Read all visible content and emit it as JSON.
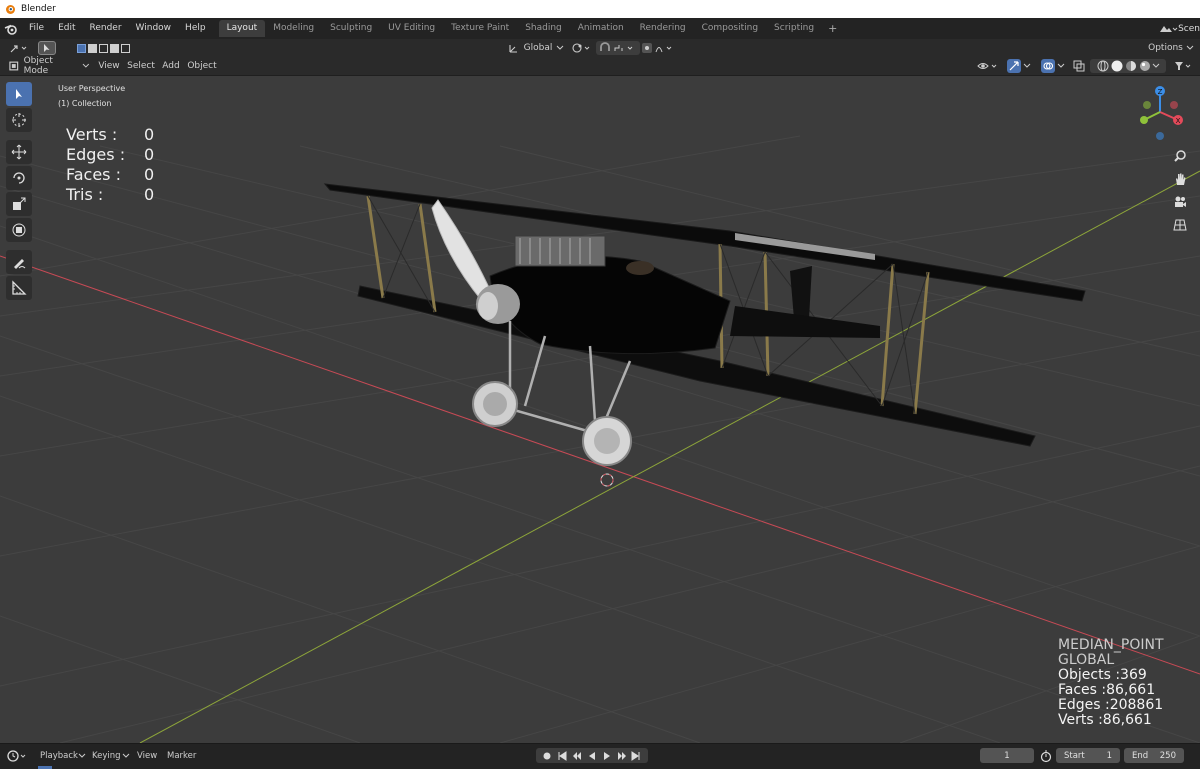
{
  "window": {
    "title": "Blender"
  },
  "menu": [
    "File",
    "Edit",
    "Render",
    "Window",
    "Help"
  ],
  "workspaces": [
    "Layout",
    "Modeling",
    "Sculpting",
    "UV Editing",
    "Texture Paint",
    "Shading",
    "Animation",
    "Rendering",
    "Compositing",
    "Scripting"
  ],
  "workspace_add": "+",
  "scene_label": "Scen",
  "tool_header": {
    "orientation": "Global",
    "options": "Options"
  },
  "view_header": {
    "mode": "Object Mode",
    "menus": [
      "View",
      "Select",
      "Add",
      "Object"
    ]
  },
  "viewport": {
    "perspective": "User Perspective",
    "collection": "(1) Collection",
    "stats": [
      {
        "label": "Verts :",
        "value": "0"
      },
      {
        "label": "Edges :",
        "value": "0"
      },
      {
        "label": "Faces :",
        "value": "0"
      },
      {
        "label": "Tris :",
        "value": "0"
      }
    ],
    "scene_stats": {
      "pivot": "MEDIAN_POINT",
      "orientation": "GLOBAL",
      "objects": "Objects :369",
      "faces": "Faces :86,661",
      "edges": "Edges :208861",
      "verts": "Verts :86,661"
    }
  },
  "gizmo": {
    "x_label": "X",
    "y_label": "Y",
    "z_label": "Z"
  },
  "timeline": {
    "menus": [
      "Playback",
      "Keying",
      "View",
      "Marker"
    ],
    "current_frame": "1",
    "start_label": "Start",
    "start_value": "1",
    "end_label": "End",
    "end_value": "250"
  },
  "colors": {
    "accent": "#4b72b0",
    "x_axis": "#e44a5a",
    "y_axis": "#8fc23a",
    "z_axis": "#3b8ee8",
    "viewport_bg": "#3c3c3c"
  }
}
